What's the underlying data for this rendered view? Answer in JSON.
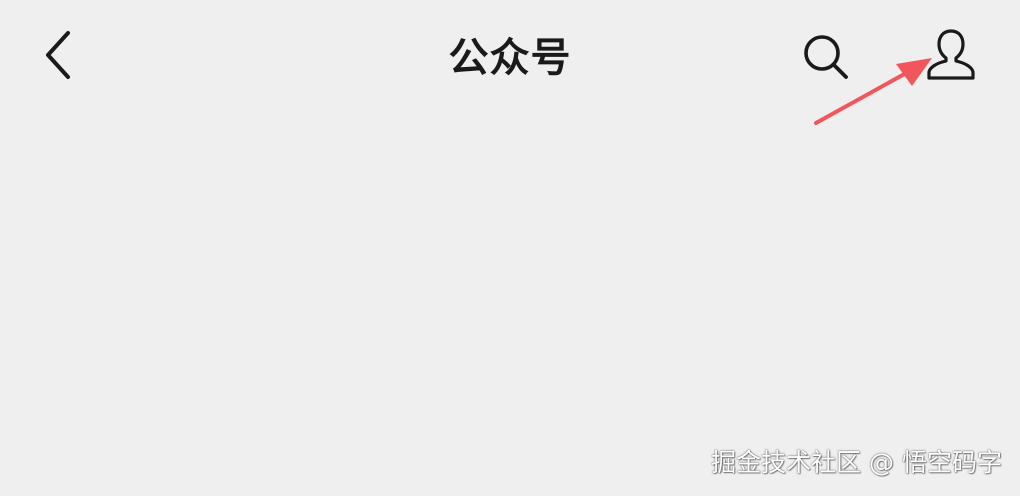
{
  "header": {
    "title": "公众号",
    "back_icon": "chevron-left-icon",
    "search_icon": "search-icon",
    "profile_icon": "user-icon"
  },
  "annotation": {
    "arrow_color": "#f0565b"
  },
  "watermark": {
    "text": "掘金技术社区 @ 悟空码字"
  },
  "colors": {
    "background": "#efefef",
    "icon": "#1a1a1a"
  }
}
